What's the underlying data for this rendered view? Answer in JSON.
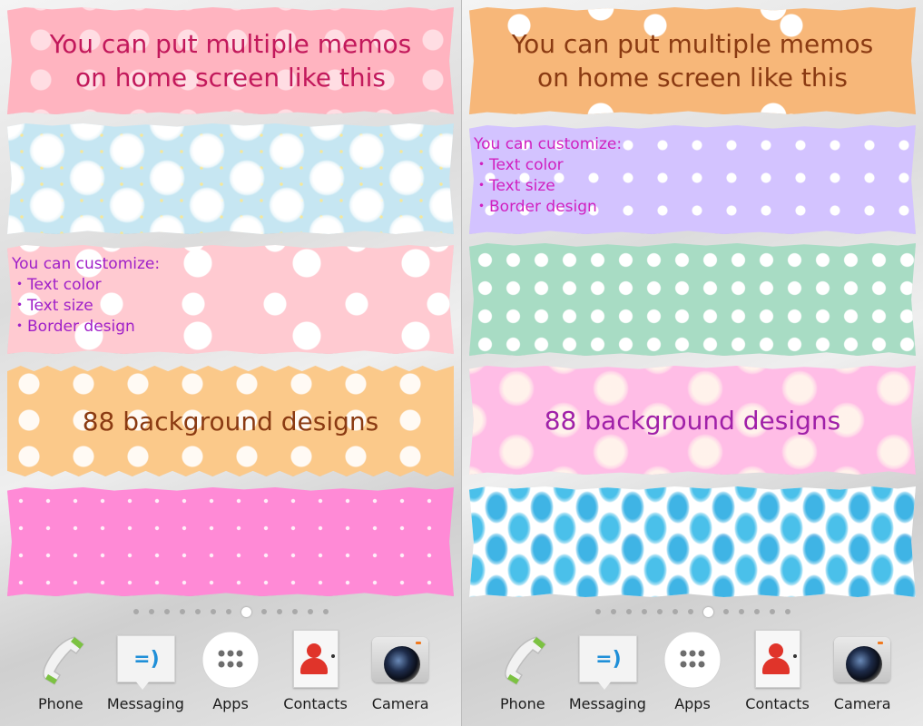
{
  "screens": [
    {
      "memos": [
        {
          "text": "You can put multiple memos\non home screen like this",
          "color": "#c2185b"
        },
        {
          "text": ""
        },
        {
          "text": "You can customize:\n・Text color\n・Text size\n・Border design",
          "color": "#a020c8"
        },
        {
          "text": "88 background designs",
          "color": "#8a3a12"
        },
        {
          "text": ""
        }
      ],
      "active_page": 7
    },
    {
      "memos": [
        {
          "text": "You can put multiple memos\non home screen like this",
          "color": "#8a3a12"
        },
        {
          "text": "You can customize:\n・Text color\n・Text size\n・Border design",
          "color": "#d020c0"
        },
        {
          "text": ""
        },
        {
          "text": "88 background designs",
          "color": "#a020a8"
        },
        {
          "text": ""
        }
      ],
      "active_page": 7
    }
  ],
  "page_count": 13,
  "dock": {
    "phone": "Phone",
    "messaging": "Messaging",
    "apps": "Apps",
    "contacts": "Contacts",
    "camera": "Camera"
  },
  "icons": {
    "phone": "phone-icon",
    "messaging": "messaging-icon",
    "apps": "apps-icon",
    "contacts": "contacts-icon",
    "camera": "camera-icon"
  }
}
